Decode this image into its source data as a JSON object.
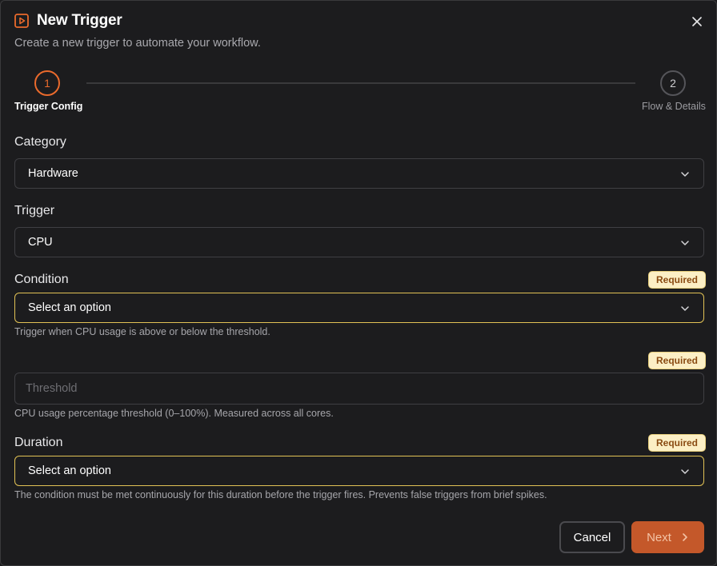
{
  "dialog": {
    "title": "New Trigger",
    "subtitle": "Create a new trigger to automate your workflow.",
    "close_icon": "close-icon",
    "title_icon": "play-square-icon"
  },
  "stepper": {
    "steps": [
      {
        "number": "1",
        "label": "Trigger Config",
        "state": "active"
      },
      {
        "number": "2",
        "label": "Flow & Details",
        "state": "inactive"
      }
    ]
  },
  "fields": {
    "category": {
      "label": "Category",
      "value": "Hardware"
    },
    "trigger": {
      "label": "Trigger",
      "value": "CPU"
    },
    "condition": {
      "label": "Condition",
      "badge": "Required",
      "placeholder": "Select an option",
      "help": "Trigger when CPU usage is above or below the threshold."
    },
    "threshold": {
      "badge": "Required",
      "placeholder": "Threshold",
      "help": "CPU usage percentage threshold (0–100%). Measured across all cores."
    },
    "duration": {
      "label": "Duration",
      "badge": "Required",
      "placeholder": "Select an option",
      "help": "The condition must be met continuously for this duration before the trigger fires. Prevents false triggers from brief spikes."
    }
  },
  "footer": {
    "cancel_label": "Cancel",
    "next_label": "Next"
  },
  "colors": {
    "accent": "#ea6a2c",
    "warning_border": "#e2c255",
    "badge_bg": "#fcefc5",
    "background": "#1c1c1e"
  }
}
